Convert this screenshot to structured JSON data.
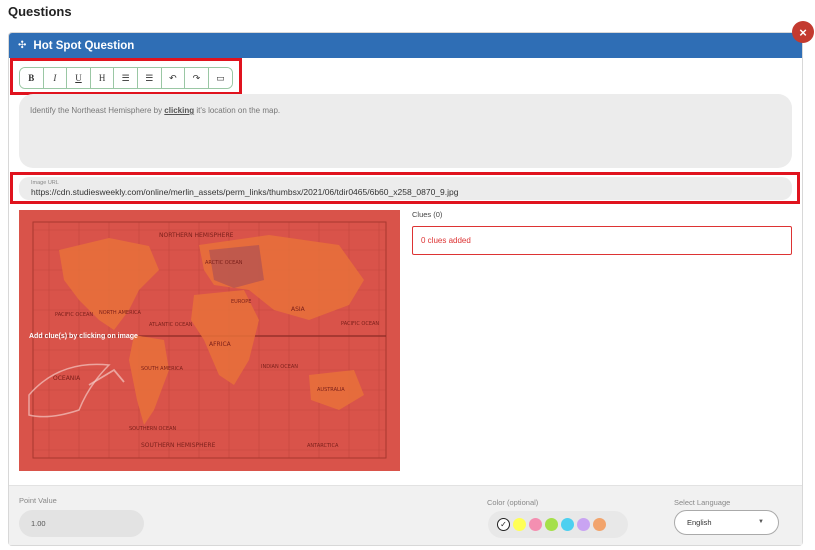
{
  "page": {
    "title": "Questions"
  },
  "question": {
    "header_title": "Hot Spot Question",
    "close_label": "×",
    "toolbar": [
      {
        "name": "bold-button",
        "label": "B",
        "icon": "bold-icon"
      },
      {
        "name": "italic-button",
        "label": "I",
        "icon": "italic-icon"
      },
      {
        "name": "underline-button",
        "label": "U",
        "icon": "underline-icon"
      },
      {
        "name": "heading-button",
        "label": "H",
        "icon": "heading-icon"
      },
      {
        "name": "bullet-list-button",
        "label": "☰",
        "icon": "bullet-list-icon"
      },
      {
        "name": "numbered-list-button",
        "label": "☰",
        "icon": "numbered-list-icon"
      },
      {
        "name": "undo-button",
        "label": "↶",
        "icon": "undo-icon"
      },
      {
        "name": "redo-button",
        "label": "↷",
        "icon": "redo-icon"
      },
      {
        "name": "embed-button",
        "label": "▭",
        "icon": "embed-icon"
      }
    ],
    "prompt_before": "Identify the Northeast Hemisphere by ",
    "prompt_bold": "clicking",
    "prompt_after": " it's location on the map.",
    "image_url_label": "Image URL",
    "image_url": "https://cdn.studiesweekly.com/online/merlin_assets/perm_links/thumbsx/2021/06/tdir0465/6b60_x258_0870_9.jpg",
    "map_hint": "Add clue(s) by clicking on image",
    "map_labels": {
      "north_hemisphere": "NORTHERN HEMISPHERE",
      "south_hemisphere": "SOUTHERN HEMISPHERE",
      "arctic": "ARCTIC OCEAN",
      "europe": "EUROPE",
      "asia": "ASIA",
      "north_america": "NORTH AMERICA",
      "africa": "AFRICA",
      "south_america": "SOUTH AMERICA",
      "oceania": "OCEANIA",
      "australia": "AUSTRALIA",
      "antarctica": "ANTARCTICA",
      "atlantic": "ATLANTIC OCEAN",
      "pacific_left": "PACIFIC OCEAN",
      "pacific_right": "PACIFIC OCEAN",
      "indian": "INDIAN OCEAN",
      "southern": "SOUTHERN OCEAN"
    },
    "clues_label": "Clues (0)",
    "clues_empty": "0 clues added"
  },
  "footer": {
    "point_label": "Point Value",
    "point_value": "1.00",
    "color_label": "Color (optional)",
    "colors": [
      "#ffff55",
      "#f48fb1",
      "#a5e04a",
      "#4dd0f0",
      "#c9a4f2",
      "#f2a46c"
    ],
    "lang_label": "Select Language",
    "lang_value": "English"
  },
  "colors": {
    "header": "#2f6eb5",
    "highlight": "#e0131e",
    "map_overlay": "#d9534a",
    "close": "#c33a2f"
  }
}
